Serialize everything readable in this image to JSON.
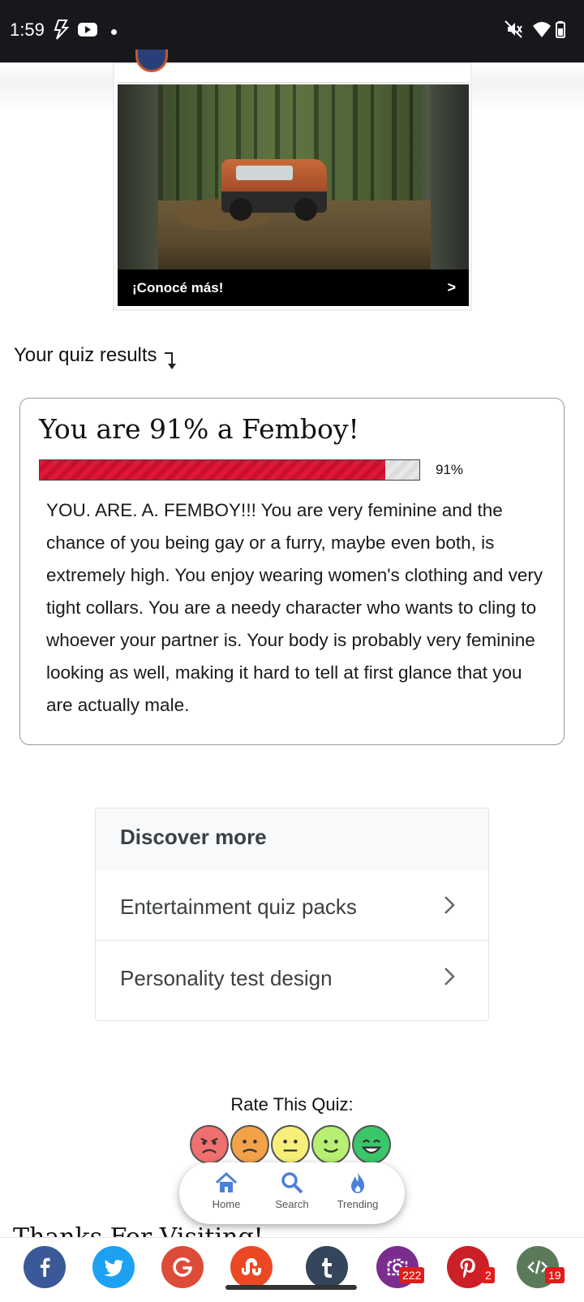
{
  "status_bar": {
    "time": "1:59",
    "icons": [
      "flash-icon",
      "youtube-icon",
      "notification-dot",
      "mute-icon",
      "wifi-icon",
      "battery-icon"
    ]
  },
  "ad": {
    "cta": "¡Conocé más!",
    "arrow": ">"
  },
  "results": {
    "heading": "Your quiz results",
    "title": "You are 91% a Femboy!",
    "percent": 91,
    "percent_label": "91%",
    "description": "YOU. ARE. A. FEMBOY!!! You are very feminine and the chance of you being gay or a furry, maybe even both, is extremely high. You enjoy wearing women's clothing and very tight collars. You are a needy character who wants to cling to whoever your partner is. Your body is probably very feminine looking as well, making it hard to tell at first glance that you are actually male."
  },
  "discover": {
    "heading": "Discover more",
    "items": [
      {
        "label": "Entertainment quiz packs"
      },
      {
        "label": "Personality test design"
      }
    ]
  },
  "rating": {
    "label": "Rate This Quiz:",
    "faces": [
      {
        "name": "angry-face-icon",
        "color": "#f07070"
      },
      {
        "name": "sad-face-icon",
        "color": "#f4a24a"
      },
      {
        "name": "neutral-face-icon",
        "color": "#f6ef7a"
      },
      {
        "name": "smile-face-icon",
        "color": "#b7ef72"
      },
      {
        "name": "grin-face-icon",
        "color": "#39c76a"
      }
    ]
  },
  "bottom_nav": {
    "items": [
      {
        "label": "Home",
        "icon": "home-icon"
      },
      {
        "label": "Search",
        "icon": "search-icon"
      },
      {
        "label": "Trending",
        "icon": "flame-icon"
      }
    ]
  },
  "footer_peek": "Thanks For Visiting!",
  "share": {
    "buttons": [
      {
        "name": "facebook",
        "color": "#3b5998"
      },
      {
        "name": "twitter",
        "color": "#1da1f2"
      },
      {
        "name": "google",
        "color": "#dd4b39"
      },
      {
        "name": "stumbleupon",
        "color": "#eb4924"
      },
      {
        "name": "tumblr",
        "color": "#35465c"
      },
      {
        "name": "screenshot",
        "color": "#7b2d8e",
        "count": "222"
      },
      {
        "name": "pinterest",
        "color": "#cb2027",
        "count": "2"
      },
      {
        "name": "embed",
        "color": "#5b7a5a",
        "count": "19"
      }
    ]
  }
}
